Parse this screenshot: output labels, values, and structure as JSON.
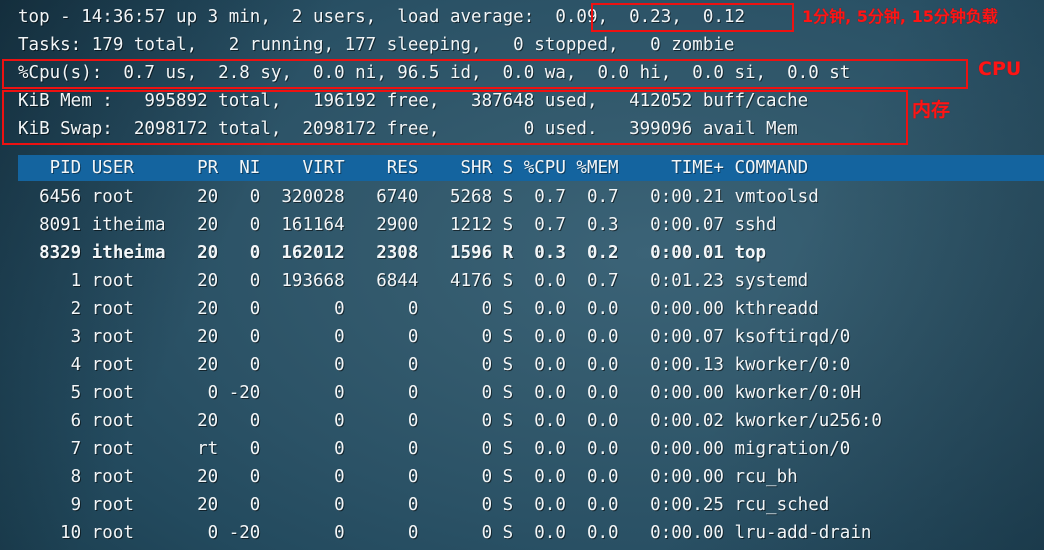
{
  "terminal": {
    "summary_lines": [
      "top - 14:36:57 up 3 min,  2 users,  load average:  0.09,  0.23,  0.12",
      "Tasks: 179 total,   2 running, 177 sleeping,   0 stopped,   0 zombie",
      "%Cpu(s):  0.7 us,  2.8 sy,  0.0 ni, 96.5 id,  0.0 wa,  0.0 hi,  0.0 si,  0.0 st",
      "KiB Mem :   995892 total,   196192 free,   387648 used,   412052 buff/cache",
      "KiB Swap:  2098172 total,  2098172 free,        0 used.   399096 avail Mem"
    ],
    "uptime": {
      "program": "top",
      "time": "14:36:57",
      "up": "3 min",
      "users": "2 users",
      "load_average_label": "load average:",
      "load_1min": "0.09",
      "load_5min": "0.23",
      "load_15min": "0.12"
    },
    "tasks": {
      "total": "179",
      "running": "2",
      "sleeping": "177",
      "stopped": "0",
      "zombie": "0"
    },
    "cpu": {
      "us": "0.7",
      "sy": "2.8",
      "ni": "0.0",
      "id": "96.5",
      "wa": "0.0",
      "hi": "0.0",
      "si": "0.0",
      "st": "0.0"
    },
    "memory": {
      "mem_total": "995892",
      "mem_free": "196192",
      "mem_used": "387648",
      "mem_buff_cache": "412052",
      "swap_total": "2098172",
      "swap_free": "2098172",
      "swap_used": "0",
      "avail_mem": "399096"
    },
    "table": {
      "header": "   PID USER      PR  NI    VIRT    RES    SHR S %CPU %MEM     TIME+ COMMAND",
      "columns": [
        "PID",
        "USER",
        "PR",
        "NI",
        "VIRT",
        "RES",
        "SHR",
        "S",
        "%CPU",
        "%MEM",
        "TIME+",
        "COMMAND"
      ],
      "rows": [
        "  6456 root      20   0  320028   6740   5268 S  0.7  0.7   0:00.21 vmtoolsd",
        "  8091 itheima   20   0  161164   2900   1212 S  0.7  0.3   0:00.07 sshd",
        "  8329 itheima   20   0  162012   2308   1596 R  0.3  0.2   0:00.01 top",
        "     1 root      20   0  193668   6844   4176 S  0.0  0.7   0:01.23 systemd",
        "     2 root      20   0       0      0      0 S  0.0  0.0   0:00.00 kthreadd",
        "     3 root      20   0       0      0      0 S  0.0  0.0   0:00.07 ksoftirqd/0",
        "     4 root      20   0       0      0      0 S  0.0  0.0   0:00.13 kworker/0:0",
        "     5 root       0 -20       0      0      0 S  0.0  0.0   0:00.00 kworker/0:0H",
        "     6 root      20   0       0      0      0 S  0.0  0.0   0:00.02 kworker/u256:0",
        "     7 root      rt   0       0      0      0 S  0.0  0.0   0:00.00 migration/0",
        "     8 root      20   0       0      0      0 S  0.0  0.0   0:00.00 rcu_bh",
        "     9 root      20   0       0      0      0 S  0.0  0.0   0:00.25 rcu_sched",
        "    10 root       0 -20       0      0      0 S  0.0  0.0   0:00.00 lru-add-drain"
      ],
      "bold_row_index": 2
    }
  },
  "annotations": {
    "load_average_label": "1分钟, 5分钟, 15分钟负载",
    "cpu_label": "CPU",
    "memory_label": "内存",
    "box_color": "#ee1111",
    "label_color": "#ff1414"
  }
}
